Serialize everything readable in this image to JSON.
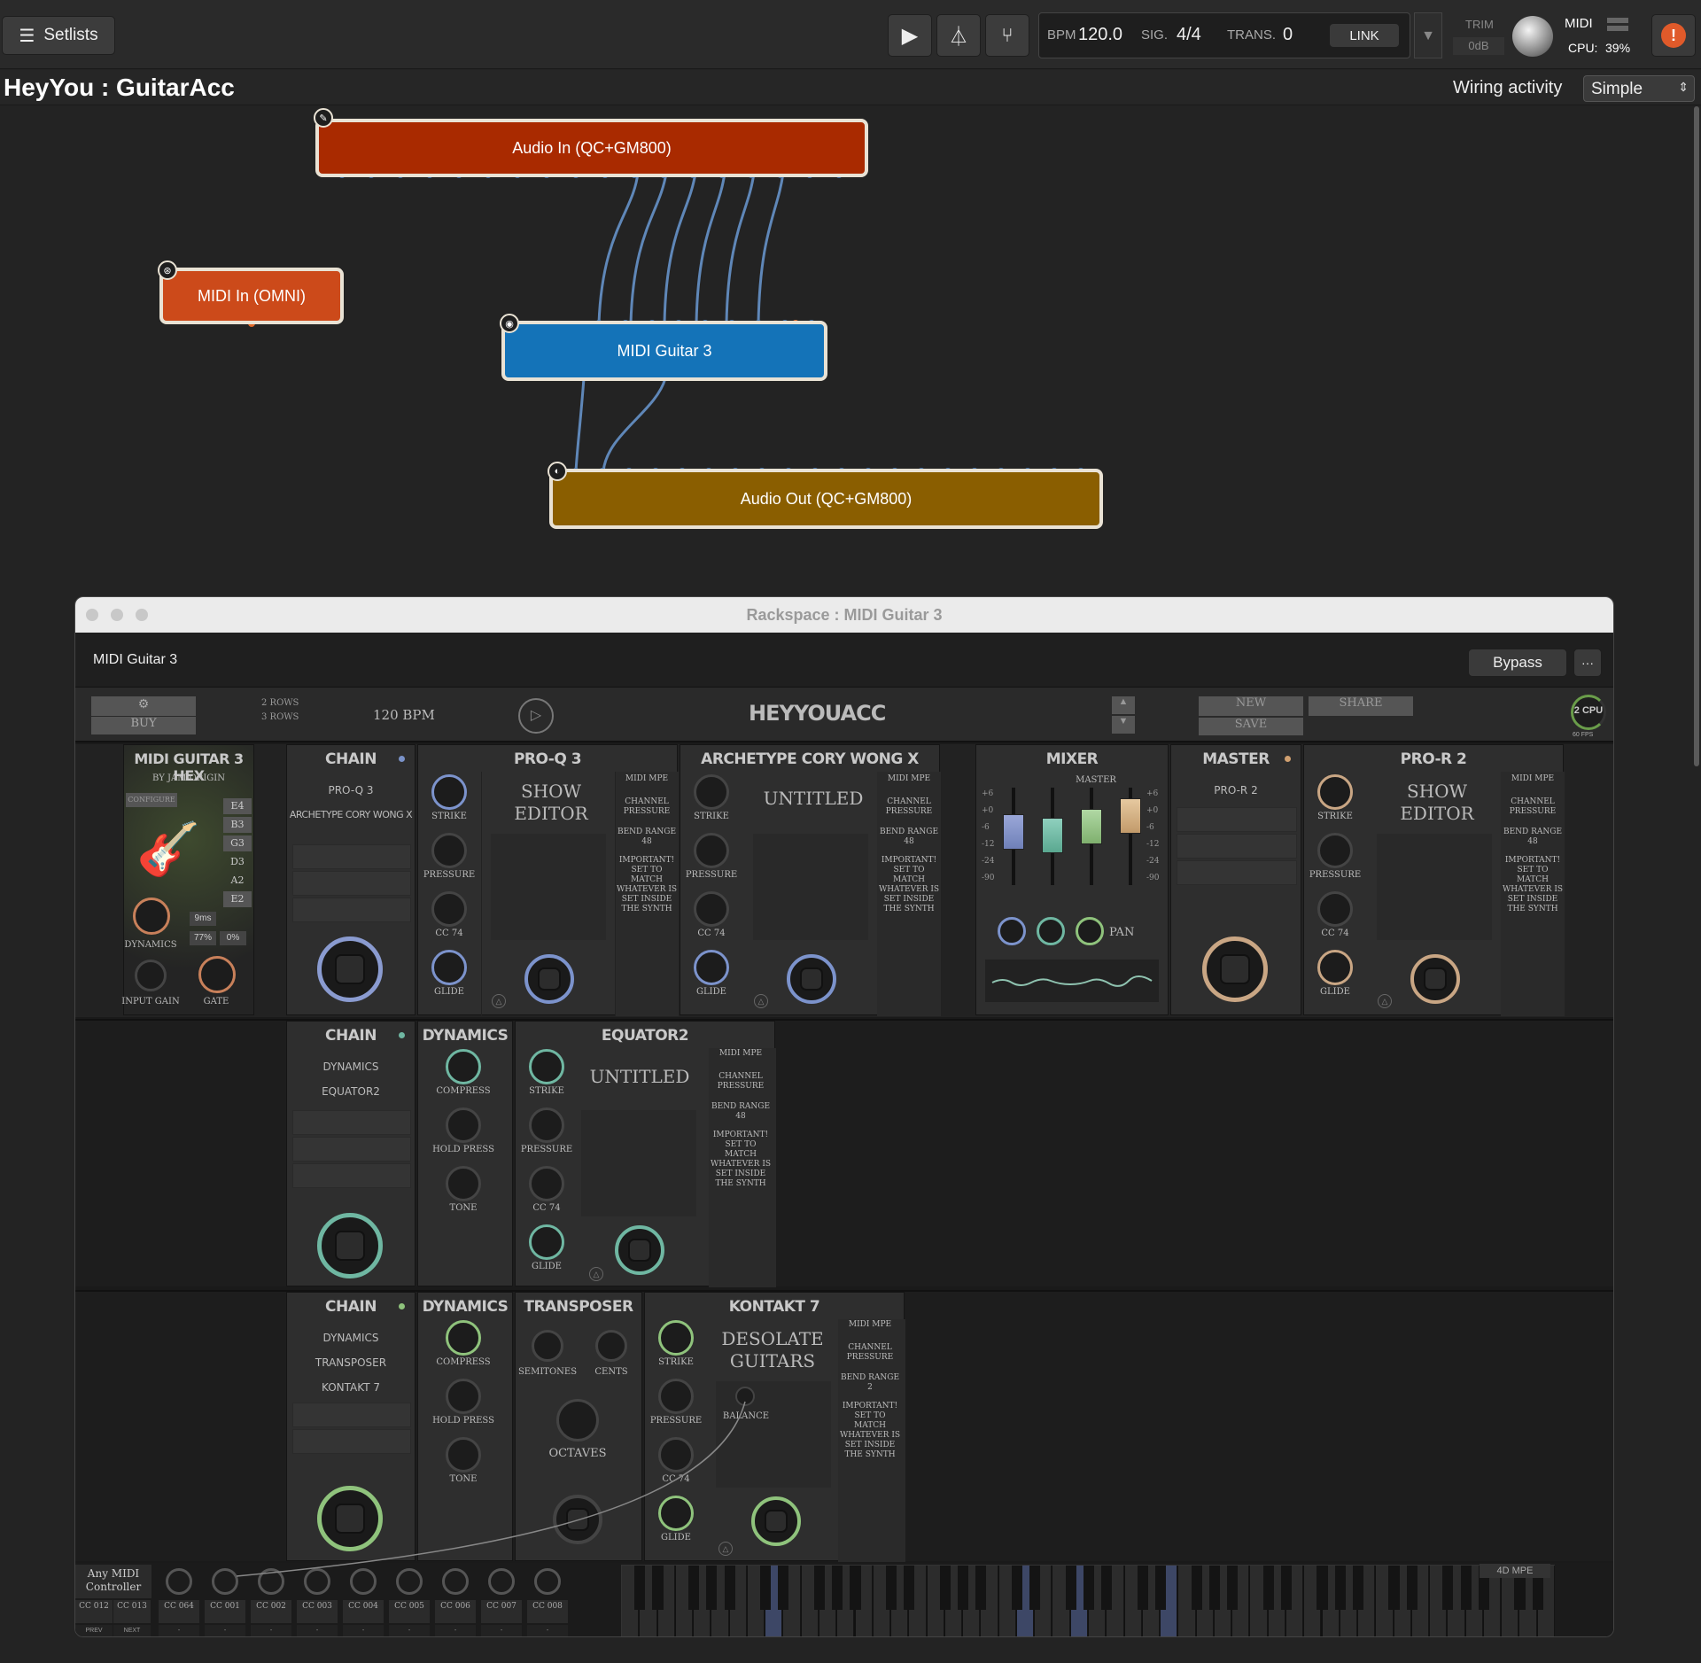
{
  "topbar": {
    "setlists_label": "Setlists",
    "bpm_label": "BPM",
    "bpm_value": "120.0",
    "sig_label": "SIG.",
    "sig_value": "4/4",
    "trans_label": "TRANS.",
    "trans_value": "0",
    "link_label": "LINK",
    "trim_label": "TRIM",
    "trim_value": "0dB",
    "midi_label": "MIDI",
    "cpu_label": "CPU:",
    "cpu_value": "39%"
  },
  "header": {
    "title": "HeyYou : GuitarAcc",
    "wiring_label": "Wiring activity",
    "wiring_mode": "Simple"
  },
  "wiring": {
    "nodes": [
      {
        "label": "Audio In (QC+GM800)",
        "color": "#a92a00"
      },
      {
        "label": "MIDI In (OMNI)",
        "color": "#cc4a1a"
      },
      {
        "label": "MIDI Guitar 3",
        "color": "#1473b8"
      },
      {
        "label": "Audio Out (QC+GM800)",
        "color": "#8a5e00"
      }
    ]
  },
  "rack": {
    "window_title": "Rackspace : MIDI Guitar 3",
    "plugin_name": "MIDI Guitar 3",
    "bypass_label": "Bypass",
    "more_label": "···",
    "buy_label": "BUY",
    "rows_1": "2 ROWS",
    "rows_2": "3 ROWS",
    "tempo": "120 BPM",
    "preset_name": "HEYYOUACC",
    "new_label": "NEW",
    "save_label": "SAVE",
    "share_label": "SHARE",
    "cpu_badge": "2 CPU",
    "fps_badge": "60 FPS",
    "hex": {
      "title": "MIDI GUITAR 3 HEX",
      "subtitle": "BY JAM ORIGIN",
      "configure": "CONFIGURE",
      "strings": [
        "E4",
        "B3",
        "G3",
        "D3",
        "A2",
        "E2"
      ],
      "latency": "9ms",
      "pct1": "77%",
      "pct2": "0%",
      "dynamics": "DYNAMICS",
      "input_gain": "INPUT GAIN",
      "gate": "GATE"
    },
    "row1": {
      "chain": {
        "title": "CHAIN",
        "items": [
          "PRO-Q 3",
          "ARCHETYPE CORY WONG X"
        ]
      },
      "proq3": {
        "title": "PRO-Q 3",
        "editor": "SHOW EDITOR"
      },
      "archetype": {
        "title": "ARCHETYPE CORY WONG X",
        "preset": "UNTITLED"
      },
      "mixer": {
        "title": "MIXER",
        "master": "MASTER",
        "pan": "PAN",
        "scale": [
          "+6",
          "+0",
          "-6",
          "-12",
          "-24",
          "-90"
        ]
      },
      "master": {
        "title": "MASTER",
        "item": "PRO-R 2"
      },
      "pror2": {
        "title": "PRO-R 2",
        "editor": "SHOW EDITOR"
      }
    },
    "row2": {
      "chain": {
        "title": "CHAIN",
        "items": [
          "DYNAMICS",
          "EQUATOR2"
        ]
      },
      "dynamics": {
        "title": "DYNAMICS"
      },
      "equator": {
        "title": "EQUATOR2",
        "preset": "UNTITLED"
      }
    },
    "row3": {
      "chain": {
        "title": "CHAIN",
        "items": [
          "DYNAMICS",
          "TRANSPOSER",
          "KONTAKT 7"
        ]
      },
      "dynamics": {
        "title": "DYNAMICS"
      },
      "transposer": {
        "title": "TRANSPOSER",
        "semitones": "SEMITONES",
        "cents": "CENTS",
        "octaves": "OCTAVES"
      },
      "kontakt": {
        "title": "KONTAKT 7",
        "preset": "DESOLATE GUITARS",
        "balance": "BALANCE"
      }
    },
    "expr_labels": [
      "STRIKE",
      "PRESSURE",
      "CC 74",
      "GLIDE"
    ],
    "dyn_labels": [
      "COMPRESS",
      "HOLD PRESS",
      "TONE"
    ],
    "mpe_labels": {
      "midi_mpe": "MIDI MPE",
      "channel_pressure": "CHANNEL PRESSURE",
      "bend_range_48": "BEND RANGE 48",
      "bend_range_2": "BEND RANGE 2",
      "important": "IMPORTANT! SET TO MATCH WHATEVER IS SET INSIDE THE SYNTH"
    },
    "controller": {
      "label": "Any MIDI Controller",
      "cc": [
        "CC 012",
        "CC 013",
        "CC 064",
        "CC 001",
        "CC 002",
        "CC 003",
        "CC 004",
        "CC 005",
        "CC 006",
        "CC 007",
        "CC 008"
      ],
      "prev_patch": "PREV PATCH",
      "next_patch": "NEXT PATCH",
      "dash": "-",
      "mode": "4D MPE"
    }
  }
}
